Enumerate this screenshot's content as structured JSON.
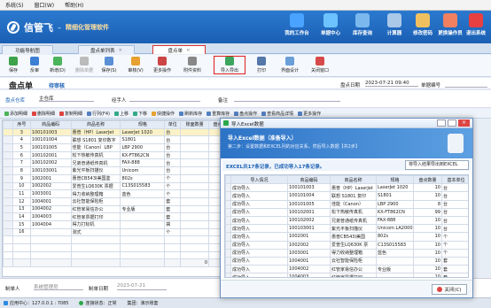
{
  "menubar": {
    "items": [
      "系统(S)",
      "窗口(W)",
      "帮助(H)"
    ]
  },
  "banner": {
    "brand": "信管飞",
    "slogan": "精细化管理软件",
    "buttons": [
      {
        "label": "我的工作台",
        "icon": "workbench-icon",
        "color": "#4aa3ff"
      },
      {
        "label": "单据中心",
        "icon": "doc-center-icon",
        "color": "#6cc3ff"
      },
      {
        "label": "库存查询",
        "icon": "stock-query-icon",
        "color": "#7ab8ee"
      },
      {
        "label": "计算器",
        "icon": "calculator-icon",
        "color": "#aac8e8"
      },
      {
        "label": "修改密码",
        "icon": "password-icon",
        "color": "#f0c060"
      },
      {
        "label": "更换操作员",
        "icon": "switch-user-icon",
        "color": "#f08060"
      },
      {
        "label": "退出系统",
        "icon": "exit-icon",
        "color": "#e84040"
      }
    ]
  },
  "tabs": [
    {
      "label": "功能导航图",
      "active": false
    },
    {
      "label": "盘点单列表",
      "active": false
    },
    {
      "label": "盘点单",
      "active": true
    }
  ],
  "toolbar": {
    "items": [
      "保存",
      "反审",
      "新增(D)",
      "删除单据",
      "保存(S)",
      "审核(V)",
      "更多操作",
      "附件资料",
      "导入导出",
      "打印",
      "界面设计",
      "关闭窗口"
    ]
  },
  "doc": {
    "title": "盘点单",
    "status": "待审核",
    "date_label": "盘点日期",
    "date_value": "2023-07-21 09:40",
    "docno_label": "单据编号",
    "store_label": "盘点仓库",
    "store_value": "主仓库",
    "handler_label": "经手人",
    "remark_label": "备注"
  },
  "gridbar": {
    "items": [
      "添加明细",
      "删除明细",
      "复制明细",
      "行列(F4)",
      "上移",
      "下移",
      "快捷操作",
      "刷新库存",
      "重算库存",
      "盘点操作",
      "查看商品详情",
      "更多操作"
    ]
  },
  "grid": {
    "headers": [
      "序号",
      "商品编码",
      "商品名称",
      "规格",
      "单位",
      "账面数量",
      "盘点数量"
    ],
    "rows": [
      [
        "3",
        "100101003",
        "惠普（HP）LaserJet",
        "LaserJet 1020",
        "台",
        "",
        "2"
      ],
      [
        "4",
        "100101004",
        "联想 S1801 复印数字",
        "S1801",
        "台",
        "",
        ""
      ],
      [
        "5",
        "100101005",
        "佳能（Canon）LBP",
        "LBP 2900",
        "台",
        "",
        "8"
      ],
      [
        "6",
        "100102001",
        "松下热敏传真机",
        "KX-FT862CN",
        "台",
        "",
        "99"
      ],
      [
        "7",
        "100102002",
        "兄弟普通纸传真机",
        "FAX-888",
        "台",
        "",
        ""
      ],
      [
        "8",
        "100103001",
        "紫光平板扫描仪",
        "Unicom",
        "台",
        "",
        ""
      ],
      [
        "9",
        "1002001",
        "惠普CB543I美国鉴",
        "802s",
        "个",
        "",
        ""
      ],
      [
        "10",
        "1002002",
        "爱普生LQ630K 票据",
        "C13S015583",
        "个",
        "",
        "0"
      ],
      [
        "11",
        "1003001",
        "得力收纳整理箱",
        "蓝色",
        "个",
        "",
        ""
      ],
      [
        "12",
        "1004001",
        "云社智能保险柜",
        "",
        "套",
        "",
        "10"
      ],
      [
        "13",
        "1004002",
        "红管家易信办公",
        "专业版",
        "套",
        "",
        ""
      ],
      [
        "14",
        "1004003",
        "红管家票据打印",
        "",
        "套",
        "",
        ""
      ],
      [
        "15",
        "1004004",
        "得力打标机",
        "",
        "袋",
        "",
        "10"
      ],
      [
        "16",
        "",
        "测式",
        "",
        "个",
        "",
        ""
      ]
    ],
    "sum_left": "0",
    "sum_right": "258"
  },
  "footer": {
    "maker_label": "制单人",
    "maker_value": "系统管理员",
    "date_label": "制单日期",
    "date_value": "2023-07-21"
  },
  "statusbar": {
    "server": "应用中心：127.0.0.1 : 7085",
    "connection": "连接状态：正常",
    "tenant": "集团：演示账套"
  },
  "dialog": {
    "title": "导入Excel数据",
    "banner_title": "导入Excel数据（准备导入）",
    "banner_sub": "第二步：设置数据和EXCEL列的对应关系，然后导入数据【共2步】",
    "result": "EXCEL共17条记录，已成功导入17条记录。",
    "export_fail_label": "将导入结果导出到EXCEL",
    "headers": [
      "导入情况",
      "商品编码",
      "商品名称",
      "规格",
      "盘点数量",
      "基本单位"
    ],
    "rows": [
      [
        "成功导入",
        "100101003",
        "惠普（HP）LaserJet",
        "LaserJet 1020",
        "10",
        "台"
      ],
      [
        "成功导入",
        "100101004",
        "联想 S1801 复印",
        "S1801",
        "10",
        "台"
      ],
      [
        "成功导入",
        "100101005",
        "佳能（Canon）",
        "LBP 2900",
        "8",
        "台"
      ],
      [
        "成功导入",
        "100102001",
        "松下热敏传真机",
        "KX-FT862CN",
        "99",
        "台"
      ],
      [
        "成功导入",
        "100102002",
        "兄弟普通纸传真机",
        "FAX-888",
        "10",
        "台"
      ],
      [
        "成功导入",
        "100103001",
        "紫光平板扫描仪",
        "Unicom LA2000",
        "10",
        "台"
      ],
      [
        "成功导入",
        "1002001",
        "惠普CB543I美国",
        "802s",
        "10",
        "个"
      ],
      [
        "成功导入",
        "1002002",
        "爱普生LQ630K 票",
        "C13S015583",
        "10",
        "个"
      ],
      [
        "成功导入",
        "1003001",
        "得力收纳整理箱",
        "蓝色",
        "10",
        "个"
      ],
      [
        "成功导入",
        "1004001",
        "云社智能保险柜",
        "",
        "10",
        "套"
      ],
      [
        "成功导入",
        "1004002",
        "红管家易信办公",
        "专业版",
        "10",
        "套"
      ],
      [
        "成功导入",
        "1004003",
        "红管家票据打印",
        "",
        "10",
        "套"
      ]
    ],
    "close_label": "关闭(C)"
  }
}
